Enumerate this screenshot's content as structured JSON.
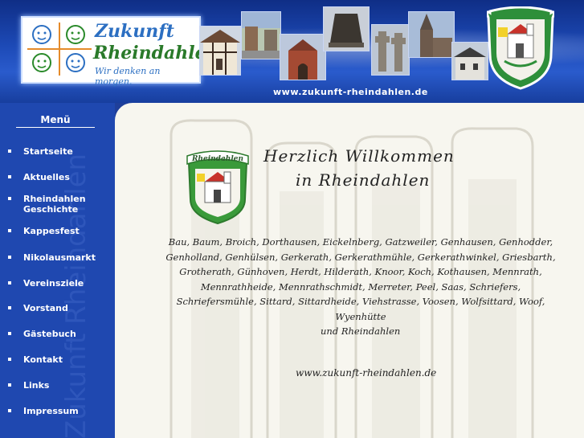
{
  "header": {
    "logo": {
      "title_line1": "Zukunft",
      "title_line2": "Rheindahlen",
      "tagline": "Wir denken an morgen."
    },
    "url_banner": "www.zukunft-rheindahlen.de",
    "photos": [
      "half-timbered-house",
      "village-street",
      "brick-church",
      "bell-sculpture",
      "stone-cross",
      "church-tower",
      "mill-building"
    ],
    "crest": "rheindahlen-coat-of-arms"
  },
  "sidebar": {
    "title": "Menü",
    "watermark": "Zukunft Rheindahlen",
    "items": [
      {
        "label": "Startseite"
      },
      {
        "label": "Aktuelles"
      },
      {
        "label": "Rheindahlen Geschichte"
      },
      {
        "label": "Kappesfest"
      },
      {
        "label": "Nikolausmarkt"
      },
      {
        "label": "Vereinsziele"
      },
      {
        "label": "Vorstand"
      },
      {
        "label": "Gästebuch"
      },
      {
        "label": "Kontakt"
      },
      {
        "label": "Links"
      },
      {
        "label": "Impressum"
      }
    ]
  },
  "main": {
    "crest_label": "Rheindahlen",
    "welcome_line1": "Herzlich Willkommen",
    "welcome_line2": "in Rheindahlen",
    "places_text": "Bau, Baum, Broich, Dorthausen, Eickelnberg, Gatzweiler, Genhausen, Genhodder, Genholland, Genhülsen, Gerkerath, Gerkerathmühle, Gerkerathwinkel, Griesbarth, Grotherath, Günhoven, Herdt, Hilderath, Knoor, Koch, Kothausen, Mennrath, Mennrathheide, Mennrathschmidt, Merreter, Peel, Saas, Schriefers, Schriefersmühle, Sittard, Sittardheide, Viehstrasse, Voosen, Wolfsittard, Woof, Wyenhütte",
    "places_tail": "und Rheindahlen",
    "site_url": "www.zukunft-rheindahlen.de"
  },
  "colors": {
    "header_blue": "#1d4ab7",
    "sidebar_blue": "#1f48b0",
    "content_bg": "#f7f6ef",
    "crest_green": "#3a9a3a",
    "crest_red": "#c8322a"
  }
}
